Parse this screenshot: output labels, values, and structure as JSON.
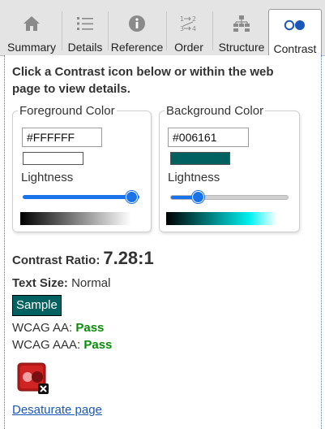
{
  "tabs": [
    {
      "label": "Summary",
      "icon": "home-icon"
    },
    {
      "label": "Details",
      "icon": "list-icon"
    },
    {
      "label": "Reference",
      "icon": "info-icon"
    },
    {
      "label": "Order",
      "icon": "order-icon"
    },
    {
      "label": "Structure",
      "icon": "structure-icon"
    },
    {
      "label": "Contrast",
      "icon": "contrast-icon",
      "active": true
    }
  ],
  "instructions": "Click a Contrast icon below or within the web page to view details.",
  "foreground": {
    "legend": "Foreground Color",
    "hex": "#FFFFFF",
    "swatch_color": "#ffffff",
    "lightness_label": "Lightness",
    "lightness_level": 1.0
  },
  "background": {
    "legend": "Background Color",
    "hex": "#006161",
    "swatch_color": "#006161",
    "lightness_label": "Lightness",
    "lightness_level": 0.19
  },
  "contrast": {
    "label": "Contrast Ratio:",
    "value": "7.28:1"
  },
  "text_size": {
    "label": "Text Size:",
    "value": "Normal"
  },
  "sample": {
    "text": "Sample",
    "fg": "#ffffff",
    "bg": "#006161"
  },
  "wcag_aa": {
    "label": "WCAG AA:",
    "result": "Pass"
  },
  "wcag_aaa": {
    "label": "WCAG AAA:",
    "result": "Pass"
  },
  "icon_name": "contrast-error-icon",
  "desaturate_link": "Desaturate page",
  "colors": {
    "accent": "#1a73e8",
    "pass": "#0a8a0a",
    "link": "#1a58b8",
    "tab_bg": "#e4e4e4"
  }
}
